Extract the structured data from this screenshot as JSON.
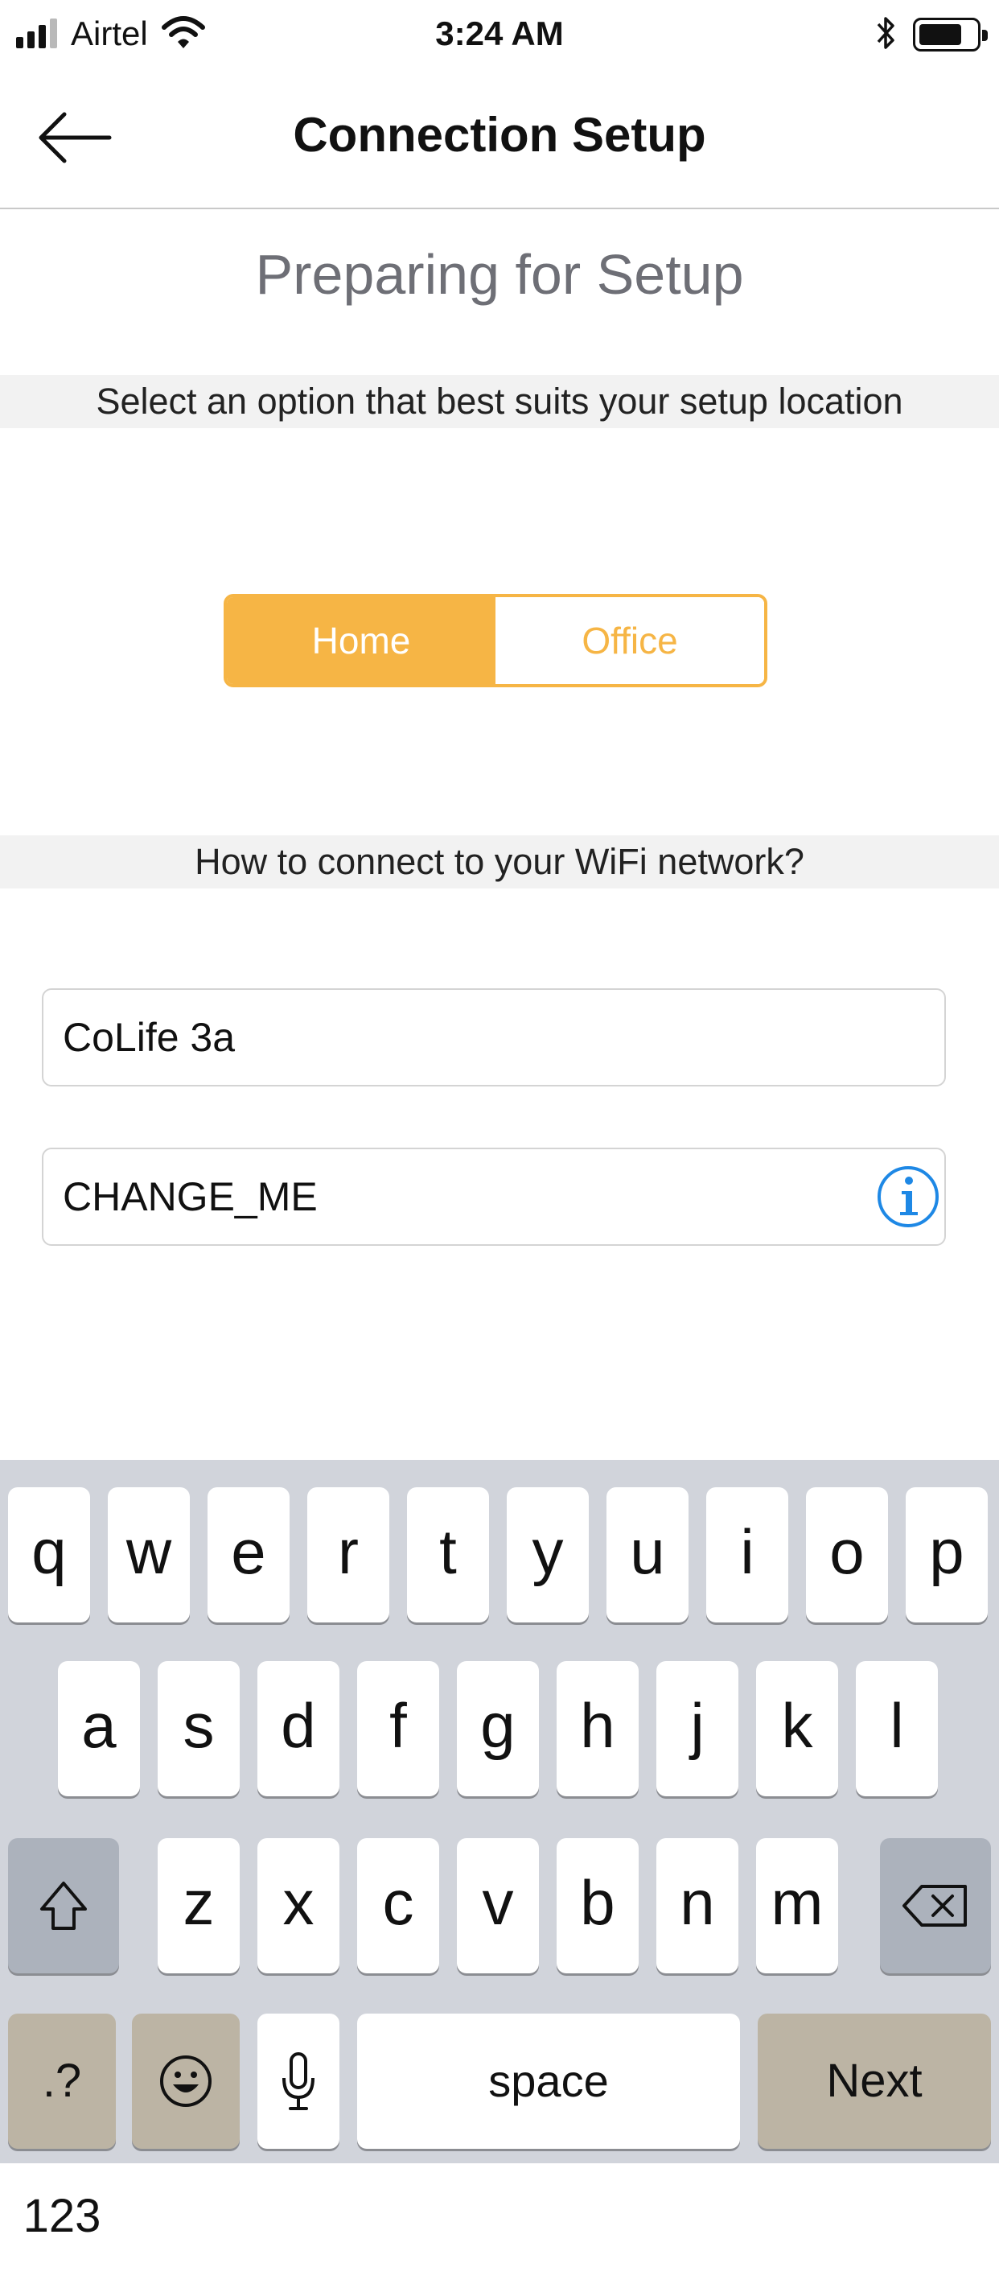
{
  "status_bar": {
    "carrier": "Airtel",
    "time": "3:24 AM",
    "icons": [
      "signal-icon",
      "wifi-icon",
      "bluetooth-icon",
      "battery-icon"
    ]
  },
  "nav": {
    "back_icon": "arrow-left-icon",
    "title": "Connection Setup"
  },
  "page": {
    "title": "Preparing for Setup",
    "location_prompt": "Select an option that best suits your setup location",
    "location_options": [
      {
        "label": "Home",
        "selected": true
      },
      {
        "label": "Office",
        "selected": false
      }
    ],
    "wifi_prompt": "How to connect to your WiFi network?",
    "ssid_value": "CoLife 3a",
    "password_value": "CHANGE_ME",
    "info_icon": "info-icon"
  },
  "colors": {
    "accent": "#f6b545",
    "info_blue": "#1e88e5",
    "band": "#f2f2f2",
    "keyboard_bg": "#d1d4db"
  },
  "keyboard": {
    "row1": [
      "q",
      "w",
      "e",
      "r",
      "t",
      "y",
      "u",
      "i",
      "o",
      "p"
    ],
    "row2": [
      "a",
      "s",
      "d",
      "f",
      "g",
      "h",
      "j",
      "k",
      "l"
    ],
    "row3": [
      "z",
      "x",
      "c",
      "v",
      "b",
      "n",
      "m"
    ],
    "shift_icon": "shift-icon",
    "backspace_icon": "backspace-icon",
    "numbers_label": ".?123",
    "emoji_icon": "emoji-icon",
    "mic_icon": "microphone-icon",
    "space_label": "space",
    "next_label": "Next"
  }
}
